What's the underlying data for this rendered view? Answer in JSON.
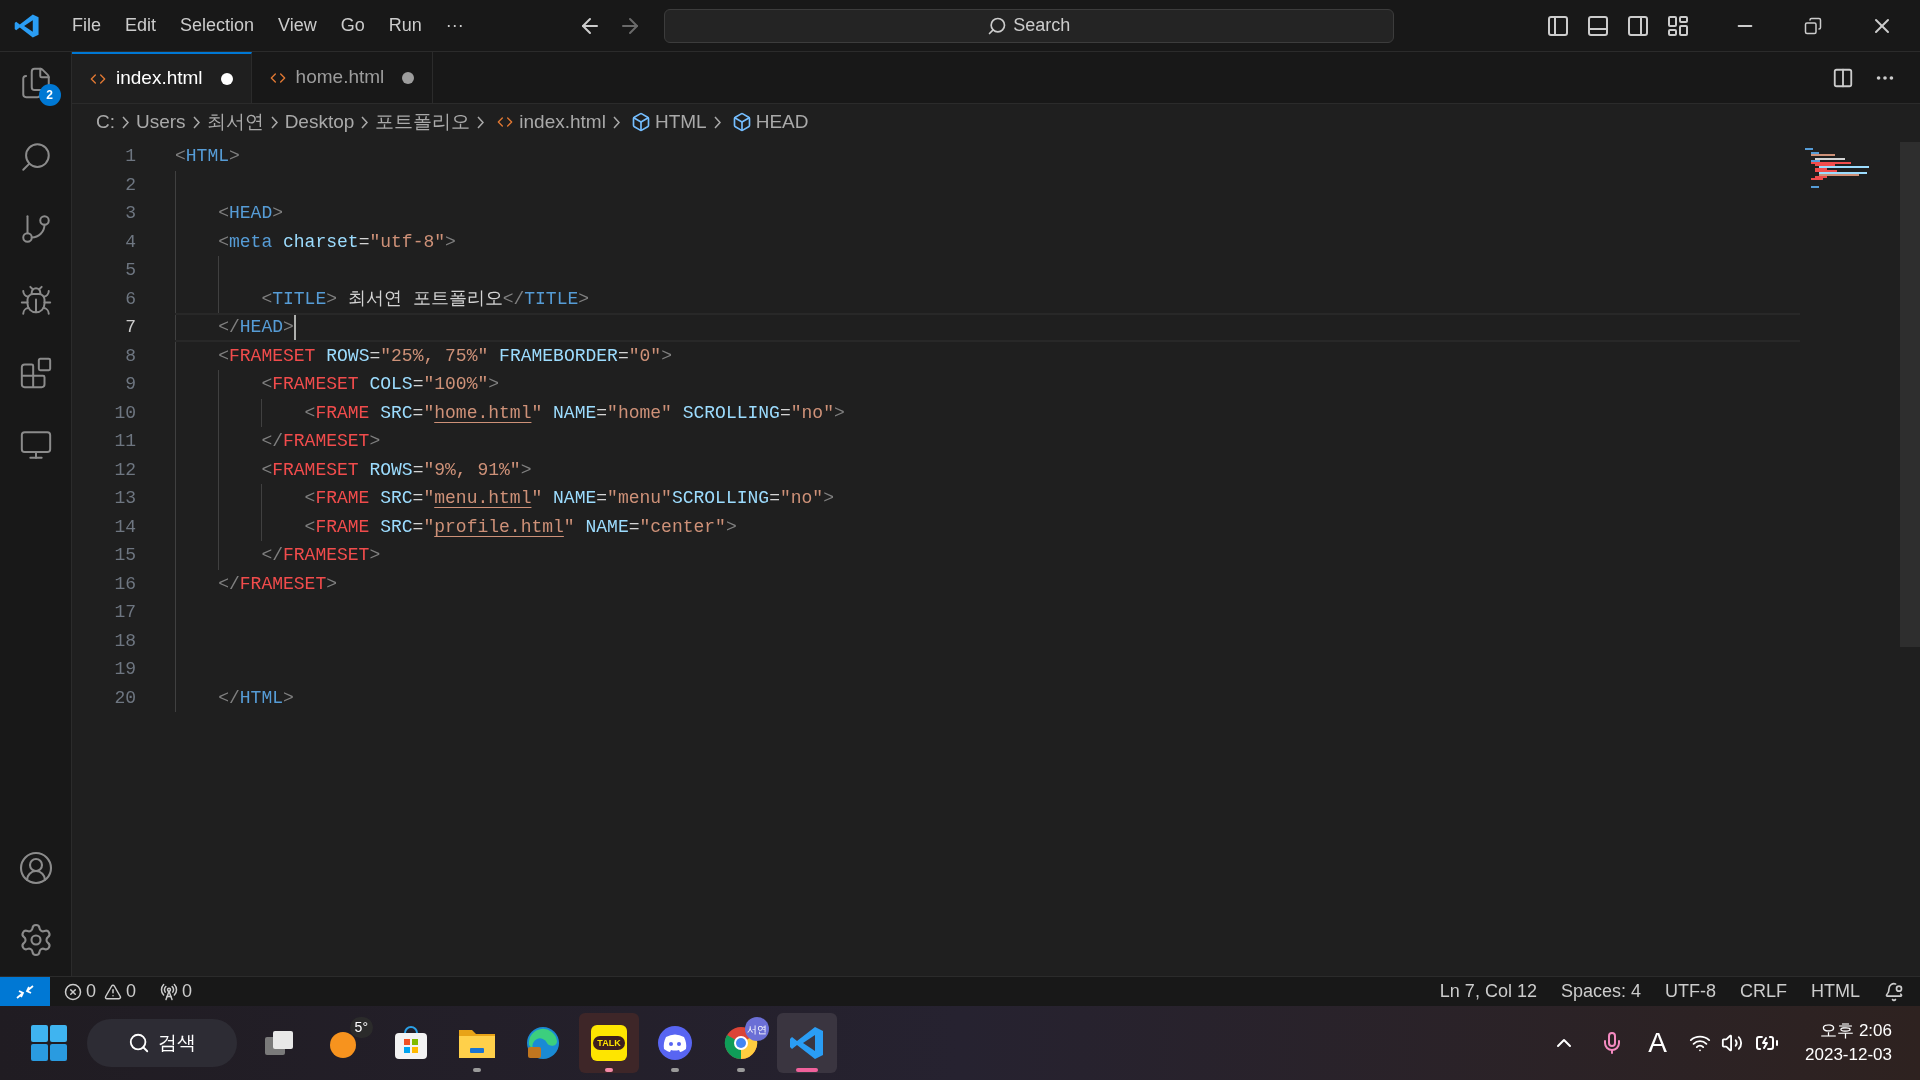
{
  "title_bar": {
    "menu": [
      "File",
      "Edit",
      "Selection",
      "View",
      "Go",
      "Run",
      "···"
    ],
    "search": {
      "placeholder": "Search"
    }
  },
  "activity_bar": {
    "badge": "2"
  },
  "tabs": [
    {
      "label": "index.html",
      "selected": true,
      "modified": true
    },
    {
      "label": "home.html",
      "selected": false,
      "modified": true
    }
  ],
  "breadcrumb": [
    {
      "label": "C:",
      "kind": "folder"
    },
    {
      "label": "Users",
      "kind": "folder"
    },
    {
      "label": "최서연",
      "kind": "folder"
    },
    {
      "label": "Desktop",
      "kind": "folder"
    },
    {
      "label": "포트폴리오",
      "kind": "folder"
    },
    {
      "label": "index.html",
      "kind": "file"
    },
    {
      "label": "HTML",
      "kind": "symbol"
    },
    {
      "label": "HEAD",
      "kind": "symbol"
    }
  ],
  "editor": {
    "lines": [
      {
        "number": "1",
        "current": false,
        "tokens": [
          {
            "kind": "punct",
            "text": "<"
          },
          {
            "kind": "tag",
            "text": "HTML"
          },
          {
            "kind": "punct",
            "text": ">"
          }
        ]
      },
      {
        "number": "2",
        "current": false,
        "guides": [
          {
            "active": false
          }
        ]
      },
      {
        "number": "3",
        "current": false,
        "guides": [
          {
            "active": false
          }
        ],
        "tokens": [
          {
            "kind": "punct",
            "text": "<"
          },
          {
            "kind": "tag",
            "text": "HEAD"
          },
          {
            "kind": "punct",
            "text": ">"
          }
        ]
      },
      {
        "number": "4",
        "current": false,
        "guides": [
          {
            "active": false
          }
        ],
        "tokens": [
          {
            "kind": "punct",
            "text": "<"
          },
          {
            "kind": "tag",
            "text": "meta"
          },
          {
            "kind": "attr",
            "text": " charset"
          },
          {
            "kind": "plain",
            "text": "="
          },
          {
            "kind": "string",
            "text": "\"utf-8\""
          },
          {
            "kind": "punct",
            "text": ">"
          }
        ]
      },
      {
        "number": "5",
        "current": false,
        "guides": [
          {
            "active": false
          },
          {
            "active": false
          }
        ]
      },
      {
        "number": "6",
        "current": false,
        "guides": [
          {
            "active": false
          },
          {
            "active": false
          }
        ],
        "tokens": [
          {
            "kind": "punct",
            "text": "<"
          },
          {
            "kind": "tag",
            "text": "TITLE"
          },
          {
            "kind": "punct",
            "text": ">"
          },
          {
            "kind": "plain",
            "text": " 최서연 포트폴리오"
          },
          {
            "kind": "punct",
            "text": "</"
          },
          {
            "kind": "tag",
            "text": "TITLE"
          },
          {
            "kind": "punct",
            "text": ">"
          }
        ]
      },
      {
        "number": "7",
        "current": true,
        "guides": [
          {
            "active": false
          }
        ],
        "tokens": [
          {
            "kind": "punct",
            "text": "</"
          },
          {
            "kind": "tag",
            "text": "HEAD"
          },
          {
            "kind": "punct",
            "text": ">"
          }
        ]
      },
      {
        "number": "8",
        "current": false,
        "guides": [
          {
            "active": false
          }
        ],
        "tokens": [
          {
            "kind": "punct",
            "text": "<"
          },
          {
            "kind": "unknown_tag",
            "text": "FRAMESET"
          },
          {
            "kind": "attr",
            "text": " ROWS"
          },
          {
            "kind": "plain",
            "text": "="
          },
          {
            "kind": "string",
            "text": "\"25%, 75%\""
          },
          {
            "kind": "attr",
            "text": " FRAMEBORDER"
          },
          {
            "kind": "plain",
            "text": "="
          },
          {
            "kind": "string",
            "text": "\"0\""
          },
          {
            "kind": "punct",
            "text": ">"
          }
        ]
      },
      {
        "number": "9",
        "current": false,
        "guides": [
          {
            "active": false
          },
          {
            "active": false
          }
        ],
        "tokens": [
          {
            "kind": "punct",
            "text": "<"
          },
          {
            "kind": "unknown_tag",
            "text": "FRAMESET"
          },
          {
            "kind": "attr",
            "text": " COLS"
          },
          {
            "kind": "plain",
            "text": "="
          },
          {
            "kind": "string",
            "text": "\"100%\""
          },
          {
            "kind": "punct",
            "text": ">"
          }
        ]
      },
      {
        "number": "10",
        "current": false,
        "guides": [
          {
            "active": false
          },
          {
            "active": false
          },
          {
            "active": false
          }
        ],
        "tokens": [
          {
            "kind": "punct",
            "text": "<"
          },
          {
            "kind": "unknown_tag",
            "text": "FRAME"
          },
          {
            "kind": "attr",
            "text": " SRC"
          },
          {
            "kind": "plain",
            "text": "="
          },
          {
            "kind": "string",
            "text": "\""
          },
          {
            "kind": "link",
            "text": "home.html"
          },
          {
            "kind": "string",
            "text": "\""
          },
          {
            "kind": "attr",
            "text": " NAME"
          },
          {
            "kind": "plain",
            "text": "="
          },
          {
            "kind": "string",
            "text": "\"home\""
          },
          {
            "kind": "attr",
            "text": " SCROLLING"
          },
          {
            "kind": "plain",
            "text": "="
          },
          {
            "kind": "string",
            "text": "\"no\""
          },
          {
            "kind": "punct",
            "text": ">"
          }
        ]
      },
      {
        "number": "11",
        "current": false,
        "guides": [
          {
            "active": false
          },
          {
            "active": false
          }
        ],
        "tokens": [
          {
            "kind": "punct",
            "text": "</"
          },
          {
            "kind": "unknown_tag",
            "text": "FRAMESET"
          },
          {
            "kind": "punct",
            "text": ">"
          }
        ]
      },
      {
        "number": "12",
        "current": false,
        "guides": [
          {
            "active": false
          },
          {
            "active": false
          }
        ],
        "tokens": [
          {
            "kind": "punct",
            "text": "<"
          },
          {
            "kind": "unknown_tag",
            "text": "FRAMESET"
          },
          {
            "kind": "attr",
            "text": " ROWS"
          },
          {
            "kind": "plain",
            "text": "="
          },
          {
            "kind": "string",
            "text": "\"9%, 91%\""
          },
          {
            "kind": "punct",
            "text": ">"
          }
        ]
      },
      {
        "number": "13",
        "current": false,
        "guides": [
          {
            "active": false
          },
          {
            "active": false
          },
          {
            "active": false
          }
        ],
        "tokens": [
          {
            "kind": "punct",
            "text": "<"
          },
          {
            "kind": "unknown_tag",
            "text": "FRAME"
          },
          {
            "kind": "attr",
            "text": " SRC"
          },
          {
            "kind": "plain",
            "text": "="
          },
          {
            "kind": "string",
            "text": "\""
          },
          {
            "kind": "link",
            "text": "menu.html"
          },
          {
            "kind": "string",
            "text": "\""
          },
          {
            "kind": "attr",
            "text": " NAME"
          },
          {
            "kind": "plain",
            "text": "="
          },
          {
            "kind": "string",
            "text": "\"menu\""
          },
          {
            "kind": "attr",
            "text": "SCROLLING"
          },
          {
            "kind": "plain",
            "text": "="
          },
          {
            "kind": "string",
            "text": "\"no\""
          },
          {
            "kind": "punct",
            "text": ">"
          }
        ]
      },
      {
        "number": "14",
        "current": false,
        "guides": [
          {
            "active": false
          },
          {
            "active": false
          },
          {
            "active": false
          }
        ],
        "tokens": [
          {
            "kind": "punct",
            "text": "<"
          },
          {
            "kind": "unknown_tag",
            "text": "FRAME"
          },
          {
            "kind": "attr",
            "text": " SRC"
          },
          {
            "kind": "plain",
            "text": "="
          },
          {
            "kind": "string",
            "text": "\""
          },
          {
            "kind": "link",
            "text": "profile.html"
          },
          {
            "kind": "string",
            "text": "\""
          },
          {
            "kind": "attr",
            "text": " NAME"
          },
          {
            "kind": "plain",
            "text": "="
          },
          {
            "kind": "string",
            "text": "\"center\""
          },
          {
            "kind": "punct",
            "text": ">"
          }
        ]
      },
      {
        "number": "15",
        "current": false,
        "guides": [
          {
            "active": false
          },
          {
            "active": false
          }
        ],
        "tokens": [
          {
            "kind": "punct",
            "text": "</"
          },
          {
            "kind": "unknown_tag",
            "text": "FRAMESET"
          },
          {
            "kind": "punct",
            "text": ">"
          }
        ]
      },
      {
        "number": "16",
        "current": false,
        "guides": [
          {
            "active": false
          }
        ],
        "tokens": [
          {
            "kind": "punct",
            "text": "</"
          },
          {
            "kind": "unknown_tag",
            "text": "FRAMESET"
          },
          {
            "kind": "punct",
            "text": ">"
          }
        ]
      },
      {
        "number": "17",
        "current": false,
        "guides": [
          {
            "active": false
          }
        ]
      },
      {
        "number": "18",
        "current": false,
        "guides": [
          {
            "active": false
          }
        ]
      },
      {
        "number": "19",
        "current": false,
        "guides": [
          {
            "active": false
          }
        ]
      },
      {
        "number": "20",
        "current": false,
        "guides": [
          {
            "active": false
          }
        ],
        "tokens": [
          {
            "kind": "punct",
            "text": "</"
          },
          {
            "kind": "tag",
            "text": "HTML"
          },
          {
            "kind": "punct",
            "text": ">"
          }
        ]
      }
    ]
  },
  "status_bar": {
    "errors": "0",
    "warnings": "0",
    "ports": "0",
    "items": [
      "Ln 7, Col 12",
      "Spaces: 4",
      "UTF-8",
      "CRLF",
      "HTML"
    ]
  },
  "taskbar": {
    "search": {
      "placeholder": "검색"
    },
    "weather": "5°",
    "apps": [
      {
        "kind": "taskview",
        "running": false,
        "selected": false
      },
      {
        "kind": "weather",
        "running": false,
        "selected": false
      },
      {
        "kind": "store",
        "running": false,
        "selected": false
      },
      {
        "kind": "explorer",
        "running": true,
        "selected": false
      },
      {
        "kind": "edge",
        "running": false,
        "selected": false
      },
      {
        "kind": "talk",
        "label": "TALK",
        "running": true,
        "selected": false
      },
      {
        "kind": "discord",
        "running": true,
        "selected": false
      },
      {
        "kind": "chrome",
        "badge": "서연",
        "running": true,
        "selected": false
      },
      {
        "kind": "vscode",
        "running": true,
        "selected": true
      }
    ],
    "tray": {
      "input_method": "A"
    },
    "clock": {
      "time": "오후 2:06",
      "date": "2023-12-03"
    }
  }
}
